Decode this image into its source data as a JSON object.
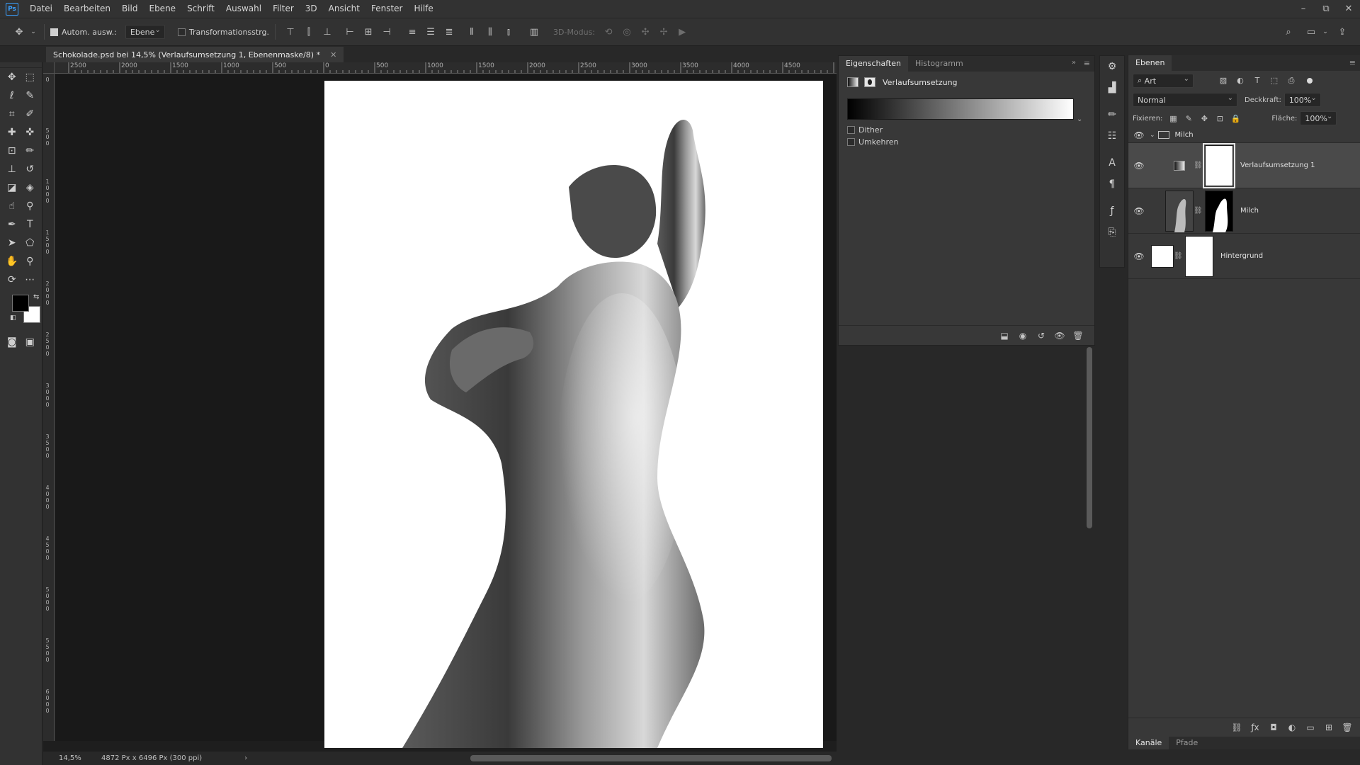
{
  "app": {
    "logo": "Ps",
    "menu": [
      "Datei",
      "Bearbeiten",
      "Bild",
      "Ebene",
      "Schrift",
      "Auswahl",
      "Filter",
      "3D",
      "Ansicht",
      "Fenster",
      "Hilfe"
    ],
    "window_controls": {
      "minimize": "–",
      "restore": "⧉",
      "close": "✕"
    }
  },
  "options_bar": {
    "auto_select_label": "Autom. ausw.:",
    "auto_select_checked": true,
    "target_value": "Ebene",
    "transform_label": "Transformationsstrg.",
    "transform_checked": false,
    "mode_3d_label": "3D-Modus:"
  },
  "document": {
    "tab_title": "Schokolade.psd bei 14,5% (Verlaufsumsetzung 1, Ebenenmaske/8) *",
    "ruler_top_labels": [
      "2500",
      "2000",
      "1500",
      "1000",
      "500",
      "0",
      "500",
      "1000",
      "1500",
      "2000",
      "2500",
      "3000",
      "3500",
      "4000",
      "4500"
    ],
    "ruler_left_labels": [
      "0",
      "5 0 0",
      "1 0 0 0",
      "1 5 0 0",
      "2 0 0 0",
      "2 5 0 0",
      "3 0 0 0",
      "3 5 0 0",
      "4 0 0 0",
      "4 5 0 0",
      "5 0 0 0",
      "5 5 0 0",
      "6 0 0 0"
    ]
  },
  "status": {
    "zoom": "14,5%",
    "doc_info": "4872 Px x 6496 Px (300 ppi)",
    "arrow": "›"
  },
  "properties": {
    "tabs": [
      "Eigenschaften",
      "Histogramm"
    ],
    "active_tab": 0,
    "title": "Verlaufsumsetzung",
    "gradient_start": "#000000",
    "gradient_end": "#ffffff",
    "dither_label": "Dither",
    "dither_checked": false,
    "reverse_label": "Umkehren",
    "reverse_checked": false
  },
  "layers_panel": {
    "tab": "Ebenen",
    "filter_kind": "Art",
    "blend_mode": "Normal",
    "opacity_label": "Deckkraft:",
    "opacity_value": "100%",
    "lock_label": "Fixieren:",
    "fill_label": "Fläche:",
    "fill_value": "100%",
    "group_name": "Milch",
    "layers": [
      {
        "name": "Verlaufsumsetzung 1",
        "type": "adjustment",
        "selected": true
      },
      {
        "name": "Milch",
        "type": "pixel",
        "selected": false
      },
      {
        "name": "Hintergrund",
        "type": "background",
        "selected": false
      }
    ],
    "bottom_tabs": [
      "Kanäle",
      "Pfade"
    ]
  }
}
